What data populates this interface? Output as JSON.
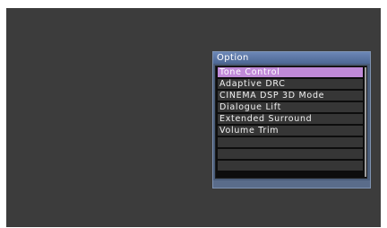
{
  "panel": {
    "title": "Option",
    "items": [
      {
        "label": "Tone Control",
        "selected": true
      },
      {
        "label": "Adaptive DRC",
        "selected": false
      },
      {
        "label": "CINEMA DSP 3D Mode",
        "selected": false
      },
      {
        "label": "Dialogue Lift",
        "selected": false
      },
      {
        "label": "Extended Surround",
        "selected": false
      },
      {
        "label": "Volume Trim",
        "selected": false
      },
      {
        "label": "",
        "selected": false
      },
      {
        "label": "",
        "selected": false
      },
      {
        "label": "",
        "selected": false
      }
    ]
  },
  "colors": {
    "screen_background": "#3c3c3c",
    "title_bar": "#5d78a6",
    "selected_item": "#c08ad8",
    "item_background": "#363636"
  }
}
